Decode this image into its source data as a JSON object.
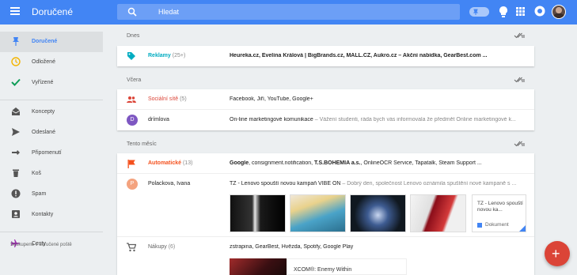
{
  "app": {
    "title": "Doručené",
    "menu_icon": "hamburger-menu-icon"
  },
  "search": {
    "placeholder": "Hledat"
  },
  "toolbar": {
    "icons": [
      "pin-toggle-icon",
      "reminder-bulb-icon",
      "apps-grid-icon",
      "notifications-icon",
      "account-avatar"
    ]
  },
  "sidebar": {
    "items": [
      {
        "label": "Doručené",
        "icon": "pin-icon",
        "active": true
      },
      {
        "label": "Odložené",
        "icon": "clock-icon"
      },
      {
        "label": "Vyřízené",
        "icon": "checkmark-icon"
      },
      {
        "label": "Koncepty",
        "icon": "drafts-icon"
      },
      {
        "label": "Odeslané",
        "icon": "send-icon"
      },
      {
        "label": "Připomenutí",
        "icon": "reminder-hand-icon"
      },
      {
        "label": "Koš",
        "icon": "trash-icon"
      },
      {
        "label": "Spam",
        "icon": "spam-icon"
      },
      {
        "label": "Kontakty",
        "icon": "contacts-icon"
      },
      {
        "label": "Cesty",
        "icon": "airplane-icon"
      }
    ],
    "footer": "Seskupeno v doručené poště"
  },
  "sections": {
    "today": {
      "title": "Dnes"
    },
    "yesterday": {
      "title": "Včera"
    },
    "month": {
      "title": "Tento měsíc"
    }
  },
  "rows": {
    "reklamy": {
      "sender": "Reklamy",
      "count": "(25+)",
      "snippet": "Heureka.cz, Evelína Králová | BigBrands.cz, MALL.CZ, Aukro.cz – Akční nabídka, GearBest.com ...",
      "color": "#00acc1"
    },
    "social": {
      "sender": "Sociální sítě",
      "count": "(5)",
      "snippet": "Facebook, Jiří, YouTube, Google+",
      "color": "#db4437"
    },
    "drimlova": {
      "initial": "D",
      "sender": "drímlova",
      "snippet_main": "On-line marketingové komunikace",
      "snippet_rest": " – Vážení studenti, ráda bych vás informovala že předmět Online marketingové k...",
      "color": "#7e57c2"
    },
    "auto": {
      "sender": "Automatické",
      "count": "(13)",
      "snippet_bold": "Google",
      "snippet_mid": ", consignment.notification, ",
      "snippet_bold2": "T.S.BOHEMIA a.s.",
      "snippet_end": ", OnlineOCR Service, Tapatalk, Steam Support ...",
      "color": "#f4511e"
    },
    "polackova": {
      "initial": "P",
      "sender": "Polackova, Ivana",
      "snippet_main": "TZ - Lenovo spouští novou kampaň VIBE ON",
      "snippet_rest": " – Dobrý den, společnost Lenovo oznámila spuštění nové kampaně s ...",
      "color": "#f4a37f"
    },
    "nakupy": {
      "sender": "Nákupy",
      "count": "(6)",
      "snippet": "zstrapina, GearBest, Hvězda, Spotify, Google Play",
      "color": "#616161"
    }
  },
  "attachment": {
    "title": "TZ - Lenovo spouští novou ka...",
    "type": "Dokument"
  },
  "promo": {
    "title": "XCOM®: Enemy Within"
  },
  "fab": {
    "label": "+"
  }
}
